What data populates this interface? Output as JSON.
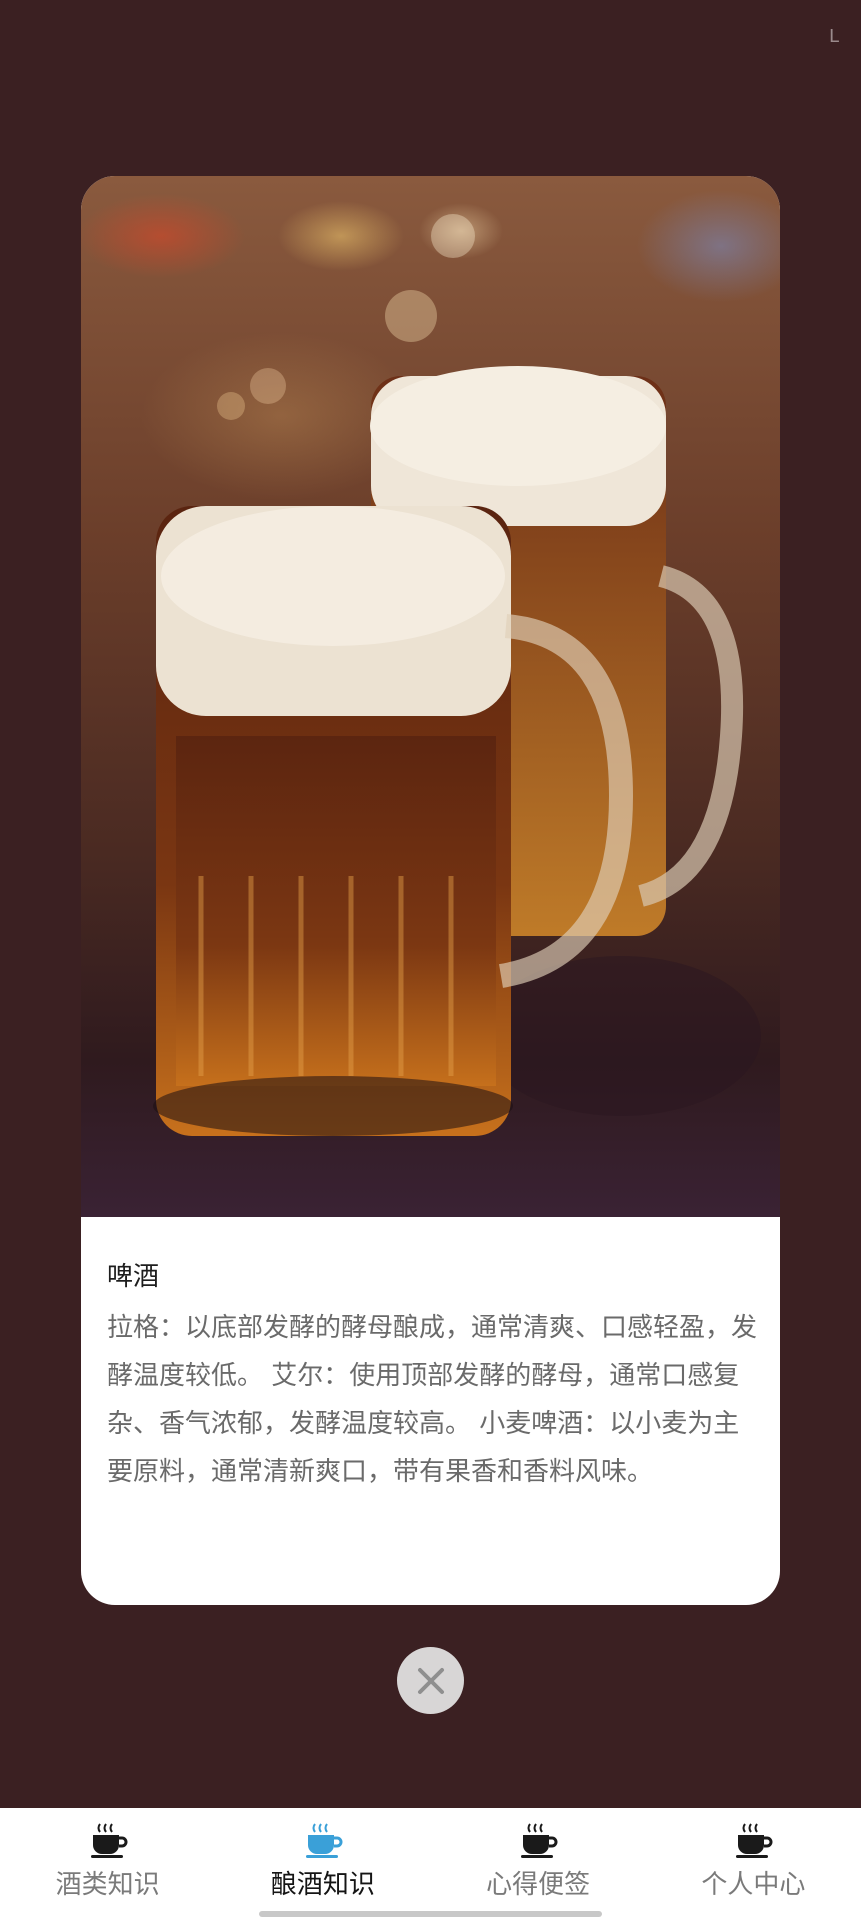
{
  "status_bar": {
    "mark": "L"
  },
  "card": {
    "title": "啤酒",
    "text": "拉格：以底部发酵的酵母酿成，通常清爽、口感轻盈，发酵温度较低。 艾尔：使用顶部发酵的酵母，通常口感复杂、香气浓郁，发酵温度较高。 小麦啤酒：以小麦为主要原料，通常清新爽口，带有果香和香料风味。",
    "image": "beer-mugs-photo"
  },
  "close_button": {
    "icon": "close-icon"
  },
  "bottom_nav": {
    "items": [
      {
        "label": "酒类知识",
        "icon": "coffee-cup-icon",
        "active": false
      },
      {
        "label": "酿酒知识",
        "icon": "coffee-cup-icon",
        "active": true
      },
      {
        "label": "心得便签",
        "icon": "coffee-cup-icon",
        "active": false
      },
      {
        "label": "个人中心",
        "icon": "coffee-cup-icon",
        "active": false
      }
    ]
  },
  "colors": {
    "background": "#3b2022",
    "active_icon": "#3aa0d8",
    "inactive_icon": "#1a1a1a",
    "card": "#ffffff"
  }
}
